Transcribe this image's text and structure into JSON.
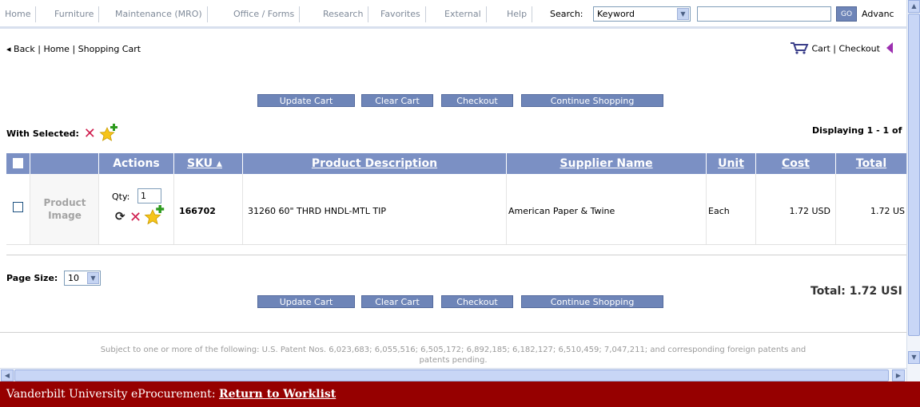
{
  "nav": {
    "items": [
      "Home",
      "Furniture",
      "Maintenance (MRO)",
      "Office / Forms",
      "Research",
      "Favorites",
      "External",
      "Help"
    ],
    "search_label": "Search:",
    "search_select": "Keyword",
    "search_value": "",
    "go_label": "GO",
    "advanced": "Advanc"
  },
  "breadcrumb": {
    "back": "◂ Back",
    "home": "Home",
    "current": "Shopping Cart",
    "sep": "|"
  },
  "cart_links": {
    "cart": "Cart",
    "checkout": "Checkout",
    "sep": "|"
  },
  "actions": {
    "update": "Update Cart",
    "clear": "Clear Cart",
    "checkout": "Checkout",
    "continue": "Continue Shopping"
  },
  "with_selected": "With Selected:",
  "displaying": "Displaying 1 - 1 of",
  "table": {
    "headers": {
      "actions": "Actions",
      "sku": "SKU ▴",
      "description": "Product Description",
      "supplier": "Supplier Name",
      "unit": "Unit",
      "cost": "Cost",
      "total": "Total"
    },
    "rows": [
      {
        "image_placeholder_1": "Product",
        "image_placeholder_2": "Image",
        "qty_label": "Qty:",
        "qty": "1",
        "sku": "166702",
        "description": "31260 60\" THRD HNDL-MTL TIP",
        "supplier": "American Paper & Twine",
        "unit": "Each",
        "cost": "1.72 USD",
        "total": "1.72 US"
      }
    ]
  },
  "page_size_label": "Page Size:",
  "page_size_value": "10",
  "total_text": "Total:  1.72 USI",
  "patent_line1": "Subject to one or more of the following: U.S. Patent Nos. 6,023,683; 6,055,516; 6,505,172; 6,892,185; 6,182,127; 6,510,459; 7,047,211; and corresponding foreign patents and",
  "patent_line2": "patents pending.",
  "footer_bar": {
    "org": "Vanderbilt University eProcurement:",
    "return_link": "Return to Worklist"
  },
  "colors": {
    "header_blue": "#7b90c4",
    "button_blue": "#6e85b8",
    "footer_red": "#960000",
    "delete_red": "#d01f4f",
    "star_gold": "#f6c419",
    "plus_green": "#2e9b1e"
  }
}
